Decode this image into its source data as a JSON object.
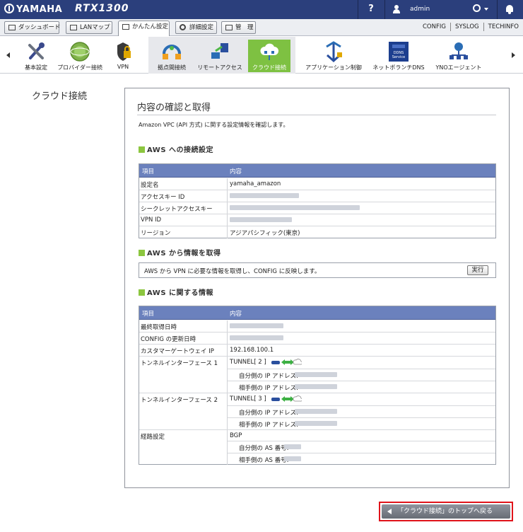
{
  "header": {
    "brand": "YAMAHA",
    "model": "RTX1300",
    "help_label": "?",
    "user_name": "admin"
  },
  "main_tabs": [
    {
      "label": "ダッシュボード",
      "icon": "dashboard-icon"
    },
    {
      "label": "LANマップ",
      "icon": "lanmap-icon"
    },
    {
      "label": "かんたん設定",
      "icon": "wizard-icon",
      "active": true
    },
    {
      "label": "詳細設定",
      "icon": "gear-icon"
    },
    {
      "label": "管　理",
      "icon": "wrench-icon"
    }
  ],
  "right_links": [
    "CONFIG",
    "SYSLOG",
    "TECHINFO"
  ],
  "toolbar": {
    "items": [
      {
        "label": "基本設定",
        "icon": "tools-icon"
      },
      {
        "label": "プロバイダー接続",
        "icon": "globe-icon"
      },
      {
        "label": "VPN",
        "icon": "vpn-lock-icon"
      },
      {
        "label": "拠点間接続",
        "icon": "site-to-site-icon"
      },
      {
        "label": "リモートアクセス",
        "icon": "remote-access-icon"
      },
      {
        "label": "クラウド接続",
        "icon": "cloud-connect-icon",
        "selected": true
      },
      {
        "label": "アプリケーション制御",
        "icon": "app-control-icon"
      },
      {
        "label": "ネットボランチDNS",
        "icon": "dns-service-icon"
      },
      {
        "label": "YNOエージェント",
        "icon": "yno-agent-icon"
      }
    ],
    "dns_icon_text": "DDNS Service"
  },
  "page": {
    "side_title": "クラウド接続",
    "panel_title": "内容の確認と取得",
    "description": "Amazon VPC (API 方式) に関する設定情報を確認します。"
  },
  "aws_settings": {
    "heading": "AWS への接続設定",
    "col_item": "項目",
    "col_content": "内容",
    "rows": [
      {
        "key": "設定名",
        "value": "yamaha_amazon"
      },
      {
        "key": "アクセスキー ID",
        "value": ""
      },
      {
        "key": "シークレットアクセスキー",
        "value": ""
      },
      {
        "key": "VPN ID",
        "value": ""
      },
      {
        "key": "リージョン",
        "value": "アジアパシフィック(東京)"
      }
    ]
  },
  "aws_fetch": {
    "heading": "AWS から情報を取得",
    "text": "AWS から VPN に必要な情報を取得し、CONFIG に反映します。",
    "button": "実行"
  },
  "aws_info": {
    "heading": "AWS に関する情報",
    "col_item": "項目",
    "col_content": "内容",
    "last_fetch": "最終取得日時",
    "config_update": "CONFIG の更新日時",
    "cgw_ip_label": "カスタマーゲートウェイ IP",
    "cgw_ip": "192.168.100.1",
    "tunnel1_label": "トンネルインターフェース 1",
    "tunnel1_value": "TUNNEL[ 2 ]",
    "tunnel2_label": "トンネルインターフェース 2",
    "tunnel2_value": "TUNNEL[ 3 ]",
    "local_ip_label": "自分側の IP アドレス:",
    "remote_ip_label": "相手側の IP アドレス:",
    "routing_label": "経路設定",
    "routing_value": "BGP",
    "local_as_label": "自分側の AS 番号:",
    "remote_as_label": "相手側の AS 番号:"
  },
  "back_button": "「クラウド接続」のトップへ戻る"
}
